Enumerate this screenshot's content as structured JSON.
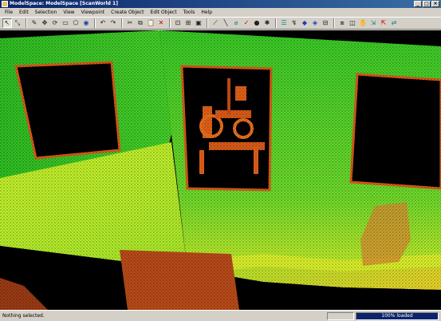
{
  "window": {
    "title": "ModelSpace: ModelSpace [ScanWorld 1]",
    "controls": {
      "minimize": "_",
      "maximize": "□",
      "close": "×"
    }
  },
  "menu": {
    "items": [
      "File",
      "Edit",
      "Selection",
      "View",
      "Viewpoint",
      "Create Object",
      "Edit Object",
      "Tools",
      "Help"
    ]
  },
  "toolbar": {
    "icons": [
      {
        "name": "select-arrow-icon",
        "glyph": "↖",
        "active": true
      },
      {
        "name": "fence-select-icon",
        "glyph": "⤡"
      },
      {
        "name": "pencil-icon",
        "glyph": "✎"
      },
      {
        "name": "move-icon",
        "glyph": "✥"
      },
      {
        "name": "rotate-icon",
        "glyph": "⟳"
      },
      {
        "name": "rectangle-select-icon",
        "glyph": "▭"
      },
      {
        "name": "polygon-select-icon",
        "glyph": "⬠"
      },
      {
        "name": "sphere-icon",
        "glyph": "◉"
      },
      {
        "name": "undo-icon",
        "glyph": "↶"
      },
      {
        "name": "redo-icon",
        "glyph": "↷"
      },
      {
        "name": "cut-icon",
        "glyph": "✂"
      },
      {
        "name": "copy-icon",
        "glyph": "⧉"
      },
      {
        "name": "paste-icon",
        "glyph": "📋"
      },
      {
        "name": "delete-icon",
        "glyph": "✕"
      },
      {
        "name": "zoom-fit-icon",
        "glyph": "⊡"
      },
      {
        "name": "zoom-window-icon",
        "glyph": "⊞"
      },
      {
        "name": "zoom-extents-icon",
        "glyph": "▣"
      },
      {
        "name": "measure-icon",
        "glyph": "⟋"
      },
      {
        "name": "line-tool-icon",
        "glyph": "╲"
      },
      {
        "name": "cylinder-icon",
        "glyph": "⌀"
      },
      {
        "name": "marker-icon",
        "glyph": "✓"
      },
      {
        "name": "point-icon",
        "glyph": "●"
      },
      {
        "name": "target-icon",
        "glyph": "✱"
      },
      {
        "name": "layers-icon",
        "glyph": "☰"
      },
      {
        "name": "shortcut-icon",
        "glyph": "↯"
      },
      {
        "name": "render-icon",
        "glyph": "◆"
      },
      {
        "name": "color-map-icon",
        "glyph": "◈"
      },
      {
        "name": "grid-icon",
        "glyph": "⊟"
      },
      {
        "name": "limit-box-icon",
        "glyph": "⧈"
      },
      {
        "name": "cut-plane-icon",
        "glyph": "◫"
      },
      {
        "name": "pan-icon",
        "glyph": "✋"
      },
      {
        "name": "walk-icon",
        "glyph": "⇲"
      },
      {
        "name": "seek-icon",
        "glyph": "⇱"
      },
      {
        "name": "orbit-icon",
        "glyph": "⇄"
      }
    ]
  },
  "viewport": {
    "label": "3D point cloud viewport"
  },
  "status": {
    "text": "Nothing selected.",
    "progress_label": "100% loaded",
    "progress_value": 1.0
  },
  "colors": {
    "background": "#000000",
    "point_green": "#3cd82a",
    "point_yellow": "#d9f01e",
    "point_orange": "#e06018",
    "titlebar": "#0a246a"
  }
}
